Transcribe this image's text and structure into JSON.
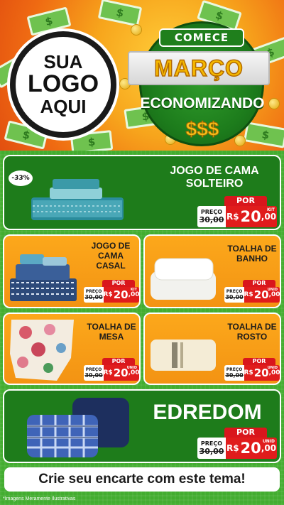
{
  "header": {
    "logo_lines": [
      "SUA",
      "LOGO",
      "AQUI"
    ],
    "badge": {
      "top": "COMECE",
      "main": "MARÇO",
      "bottom": "ECONOMIZANDO",
      "symbols": "$$$"
    },
    "bill_symbol": "$"
  },
  "products": [
    {
      "title": "JOGO DE CAMA SOLTEIRO",
      "discount": "-33%",
      "price": {
        "por": "POR",
        "label": "PREÇO",
        "old": "30,00",
        "currency": "R$",
        "value": "20",
        "cents": ",00",
        "unit": "KIT"
      }
    },
    {
      "title": "JOGO DE CAMA CASAL",
      "price": {
        "por": "POR",
        "label": "PREÇO",
        "old": "30,00",
        "currency": "R$",
        "value": "20",
        "cents": ",00",
        "unit": "KIT"
      }
    },
    {
      "title": "TOALHA DE BANHO",
      "price": {
        "por": "POR",
        "label": "PREÇO",
        "old": "30,00",
        "currency": "R$",
        "value": "20",
        "cents": ",00",
        "unit": "UNID"
      }
    },
    {
      "title": "TOALHA DE MESA",
      "price": {
        "por": "POR",
        "label": "PREÇO",
        "old": "30,00",
        "currency": "R$",
        "value": "20",
        "cents": ",00",
        "unit": "UNID"
      }
    },
    {
      "title": "TOALHA DE ROSTO",
      "price": {
        "por": "POR",
        "label": "PREÇO",
        "old": "30,00",
        "currency": "R$",
        "value": "20",
        "cents": ",00",
        "unit": "UNID"
      }
    },
    {
      "title": "EDREDOM",
      "price": {
        "por": "POR",
        "label": "PREÇO",
        "old": "30,00",
        "currency": "R$",
        "value": "20",
        "cents": ",00",
        "unit": "UNID"
      }
    }
  ],
  "footer": {
    "cta": "Crie seu encarte com este tema!",
    "note": "*Imagens Meramente Ilustrativas"
  },
  "colors": {
    "green_panel": "#1e7c1b",
    "orange_panel": "#f7a01a",
    "price_red": "#e01c1c",
    "background_green": "#43ad30"
  }
}
